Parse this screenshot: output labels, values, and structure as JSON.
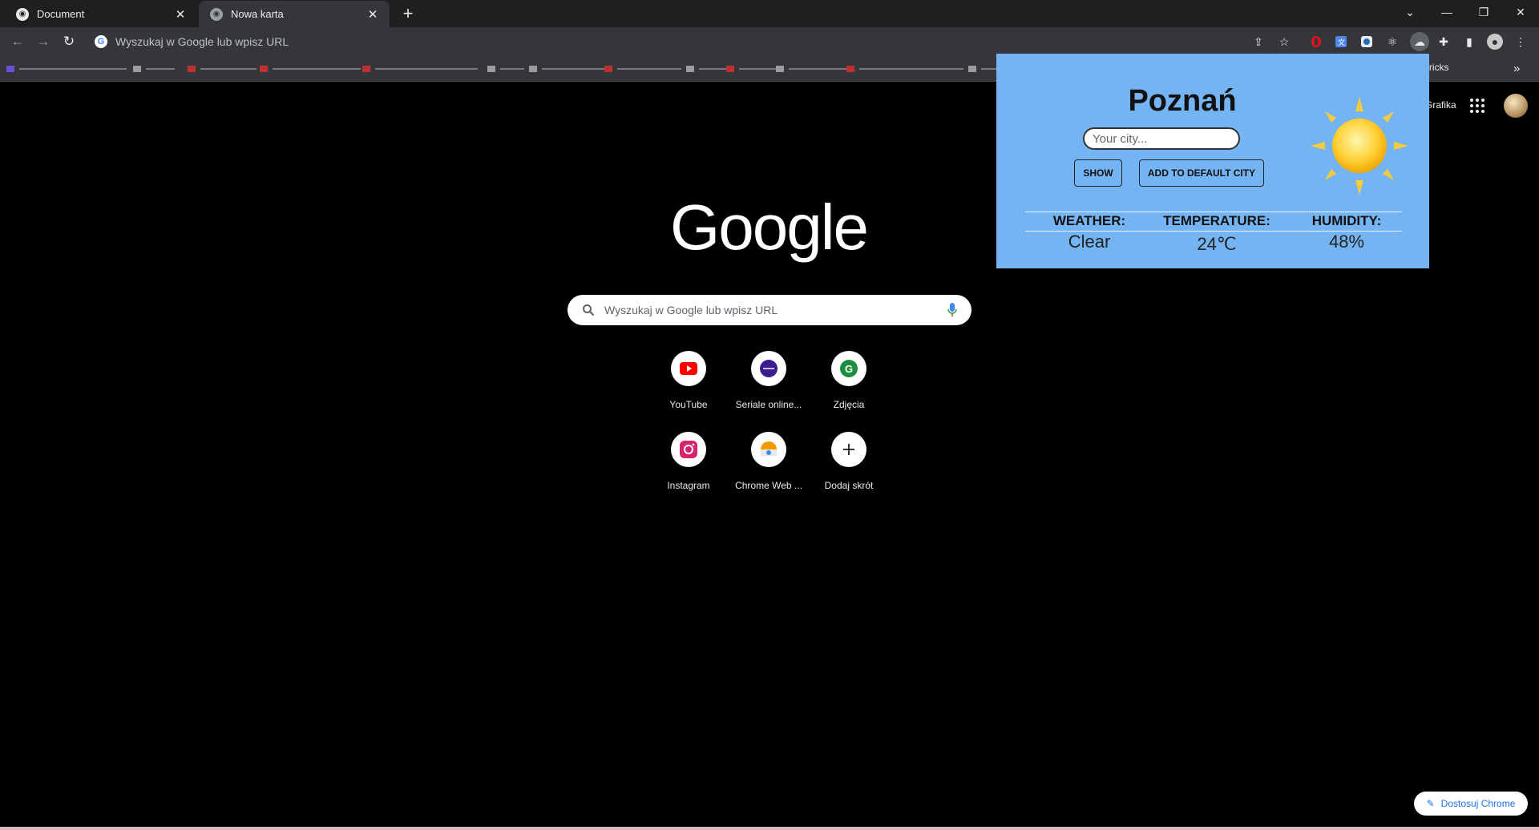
{
  "browser": {
    "tabs": [
      {
        "label": "Document",
        "active": false
      },
      {
        "label": "Nowa karta",
        "active": true
      }
    ],
    "new_tab_icon": "plus-icon",
    "omnibox_placeholder": "Wyszukaj w Google lub wpisz URL",
    "bookmarks_overflow_label": "-Tricks"
  },
  "ntp": {
    "header_link": "Grafika",
    "logo_text": "Google",
    "search_placeholder": "Wyszukaj w Google lub wpisz URL",
    "shortcuts": [
      {
        "label": "YouTube",
        "icon": "youtube-icon",
        "color": "#ff0000"
      },
      {
        "label": "Seriale online...",
        "icon": "seriale-icon",
        "color": "#3b1c8c"
      },
      {
        "label": "Zdjęcia",
        "icon": "zdjecia-icon",
        "color": "#1e8e3e"
      },
      {
        "label": "Instagram",
        "icon": "instagram-icon",
        "color": "#e1306c"
      },
      {
        "label": "Chrome Web ...",
        "icon": "chrome-web-store-icon",
        "color": "#f29900"
      },
      {
        "label": "Dodaj skrót",
        "icon": "plus-icon",
        "color": "#202124"
      }
    ],
    "customize_label": "Dostosuj Chrome"
  },
  "weather_popup": {
    "city": "Poznań",
    "city_placeholder": "Your city...",
    "show_button": "SHOW",
    "add_default_button": "ADD TO DEFAULT CITY",
    "icon": "sun-icon",
    "headers": {
      "weather": "WEATHER:",
      "temperature": "TEMPERATURE:",
      "humidity": "HUMIDITY:"
    },
    "values": {
      "weather": "Clear",
      "temperature": "24℃",
      "humidity": "48%"
    },
    "background_color": "#75b4f2"
  }
}
